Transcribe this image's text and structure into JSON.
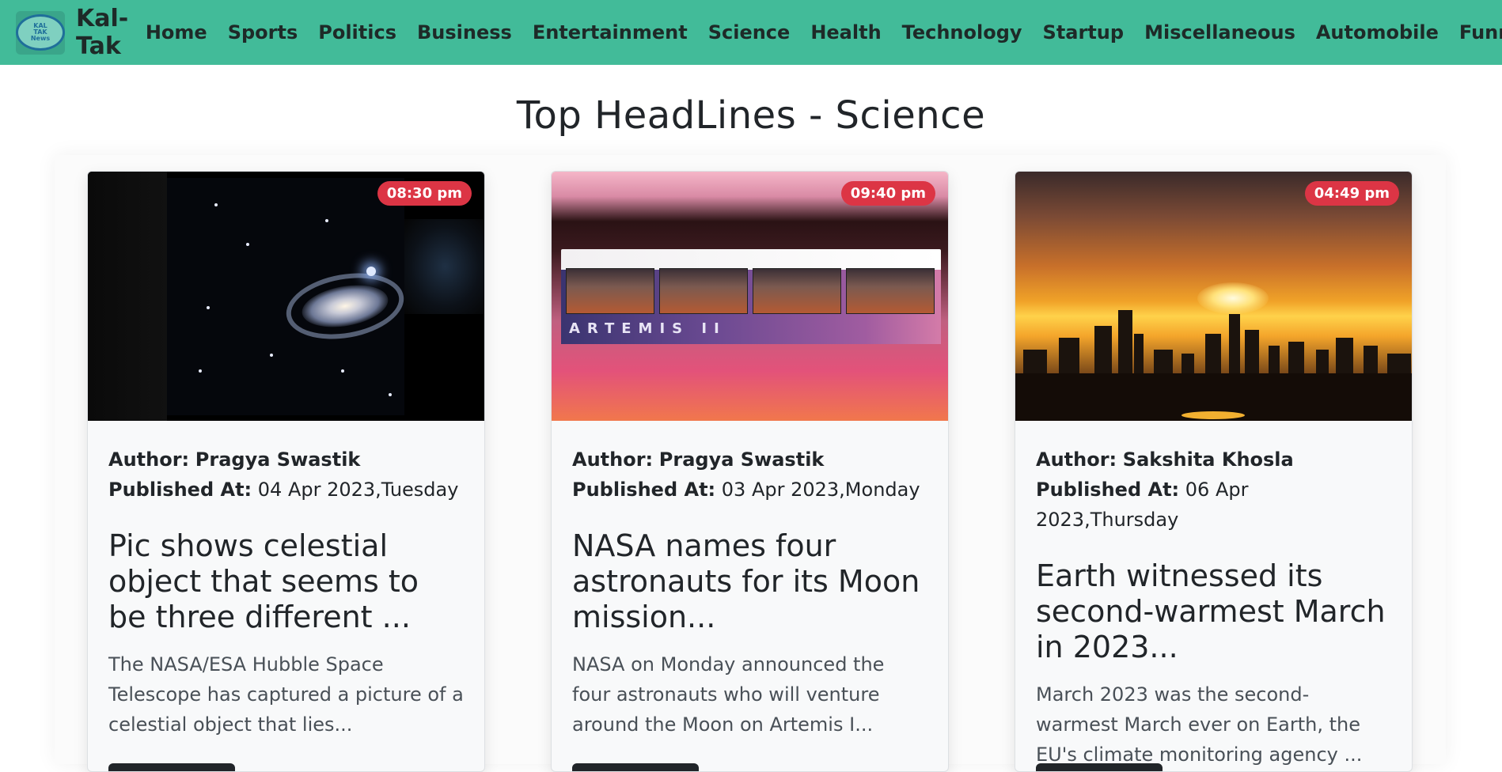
{
  "navbar": {
    "logo_text": [
      "KAL",
      "TAK",
      "News"
    ],
    "brand": "Kal-Tak",
    "links": [
      "Home",
      "Sports",
      "Politics",
      "Business",
      "Entertainment",
      "Science",
      "Health",
      "Technology",
      "Startup",
      "Miscellaneous",
      "Automobile",
      "Funny"
    ],
    "bg_color": "#42bb99"
  },
  "page_title": "Top HeadLines - Science",
  "cards": [
    {
      "time": "08:30 pm",
      "author_label": "Author:",
      "author": "Pragya Swastik",
      "published_label": "Published At:",
      "published": "04 Apr 2023,Tuesday",
      "headline": "Pic shows celestial object that seems to be three different ...",
      "description": "The NASA/ESA Hubble Space Telescope has captured a picture of a celestial object that lies..."
    },
    {
      "time": "09:40 pm",
      "author_label": "Author:",
      "author": "Pragya Swastik",
      "published_label": "Published At:",
      "published": "03 Apr 2023,Monday",
      "headline": "NASA names four astronauts for its Moon mission...",
      "description": "NASA on Monday announced the four astronauts who will venture around the Moon on Artemis I...",
      "image_text": "ARTEMIS II"
    },
    {
      "time": "04:49 pm",
      "author_label": "Author:",
      "author": "Sakshita Khosla",
      "published_label": "Published At:",
      "published": "06 Apr 2023,Thursday",
      "headline": "Earth witnessed its second-warmest March in 2023...",
      "description": "March 2023 was the second-warmest March ever on Earth, the EU's climate monitoring agency ..."
    }
  ],
  "colors": {
    "badge": "#dc3545",
    "button": "#212529"
  }
}
